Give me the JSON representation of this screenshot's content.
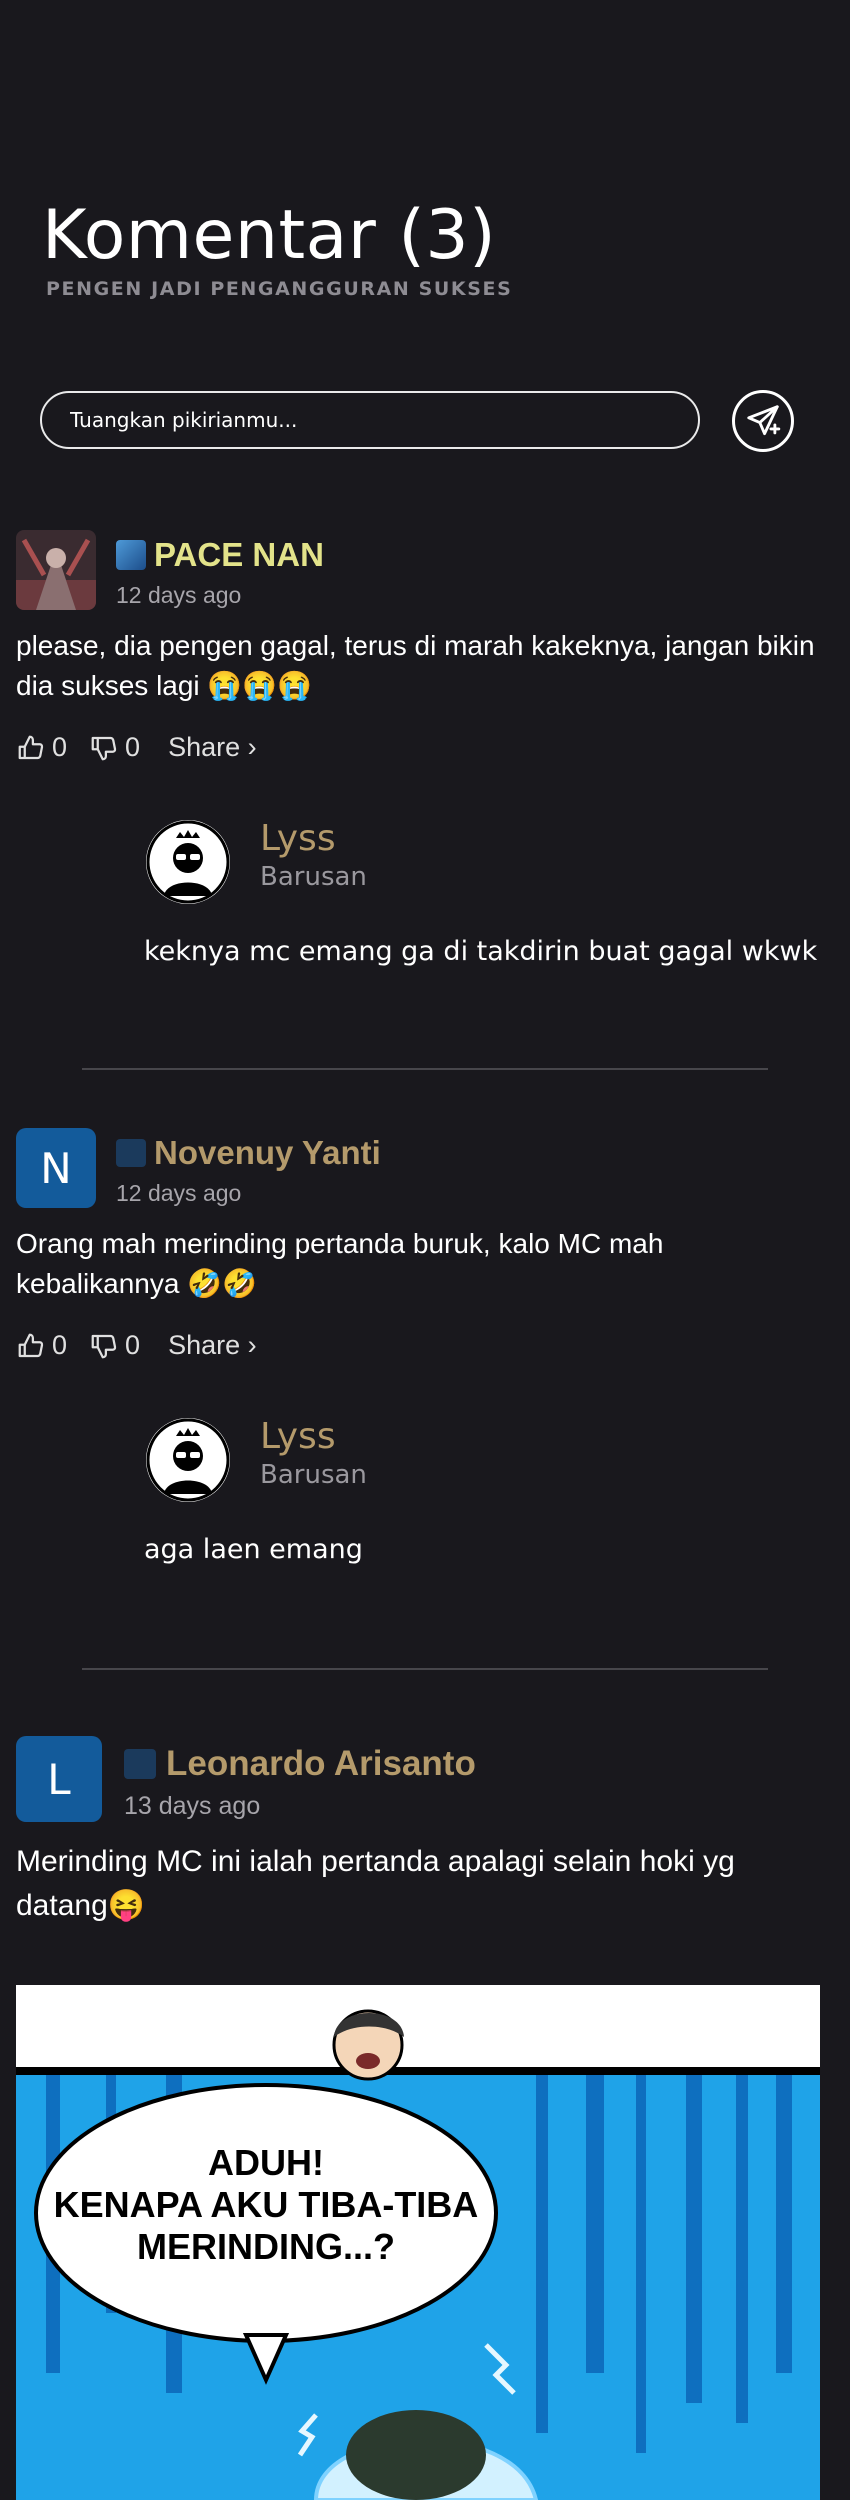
{
  "header": {
    "title": "Komentar (3)",
    "subtitle": "PENGEN JADI PENGANGGURAN SUKSES"
  },
  "comment_form": {
    "placeholder": "Tuangkan pikirianmu...",
    "send_icon": "send-icon"
  },
  "comments": [
    {
      "name": "PACE NAN",
      "name_color": "#e3e38a",
      "time": "12 days ago",
      "text": "please, dia pengen gagal, terus di marah kakeknya, jangan bikin dia sukses lagi 😭😭😭",
      "likes": "0",
      "dislikes": "0",
      "share": "Share ›",
      "reply": {
        "name": "Lyss",
        "time": "Barusan",
        "text": "keknya mc emang ga di takdirin buat gagal wkwk"
      }
    },
    {
      "avatar_letter": "N",
      "name": "Novenuy Yanti",
      "name_color": "#b49a6b",
      "time": "12 days ago",
      "text": "Orang mah merinding pertanda buruk, kalo MC mah kebalikannya 🤣🤣",
      "likes": "0",
      "dislikes": "0",
      "share": "Share ›",
      "reply": {
        "name": "Lyss",
        "time": "Barusan",
        "text": "aga laen emang"
      }
    },
    {
      "avatar_letter": "L",
      "name": "Leonardo Arisanto",
      "name_color": "#b49a6b",
      "time": "13 days ago",
      "text": "Merinding MC ini ialah pertanda apalagi selain hoki yg datang😝",
      "comic_text": "ADUH!\nKENAPA AKU TIBA-TIBA\nMERINDING...?"
    }
  ]
}
